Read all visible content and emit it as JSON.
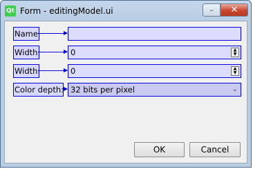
{
  "window": {
    "title": "Form - editingModel.ui",
    "app_icon": "Qt",
    "minimize_glyph": "–",
    "close_glyph": "✕"
  },
  "form": {
    "name_label": "Name:",
    "name_value": "",
    "width1_label": "Width:",
    "width1_value": "0",
    "width2_label": "Width:",
    "width2_value": "0",
    "color_depth_label": "Color depth:",
    "color_depth_value": "32 bits per pixel"
  },
  "buttons": {
    "ok": "OK",
    "cancel": "Cancel"
  },
  "icons": {
    "spin_up": "▲",
    "spin_down": "▼",
    "combo": "chevron-down-icon",
    "combo_glyph": "⌄"
  },
  "colors": {
    "buddy_outline": "#0000d8",
    "widget_fill": "#dcdcff"
  }
}
